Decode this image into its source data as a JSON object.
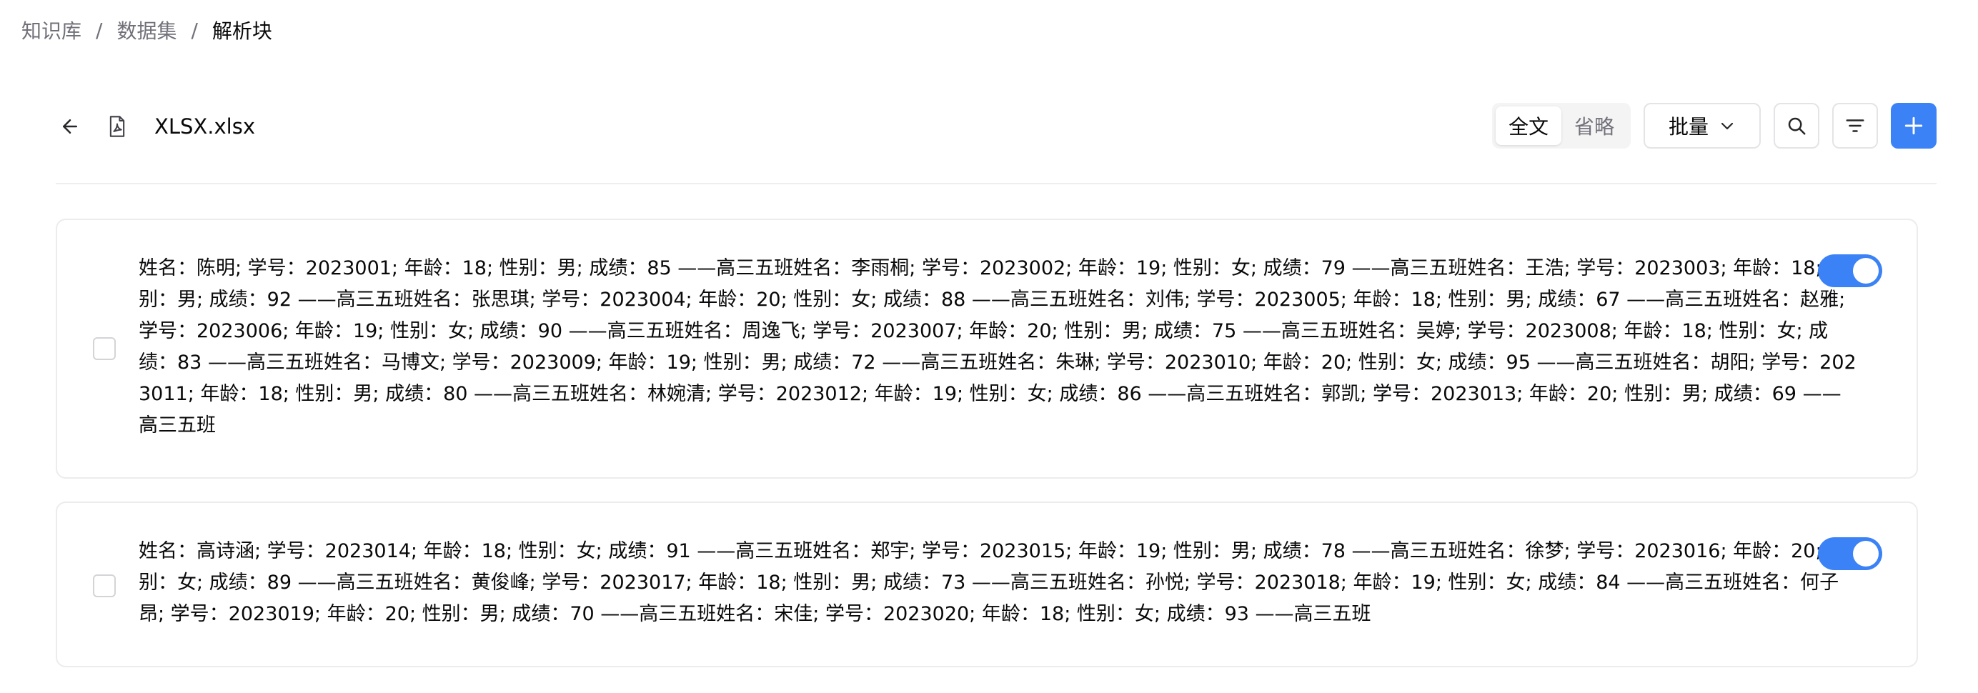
{
  "breadcrumb": {
    "items": [
      "知识库",
      "数据集",
      "解析块"
    ],
    "separator": "/"
  },
  "file": {
    "name": "XLSX.xlsx"
  },
  "toolbar": {
    "view_options": [
      "全文",
      "省略"
    ],
    "active_view": "全文",
    "batch_label": "批量"
  },
  "chunks": [
    {
      "text": "姓名：陈明; 学号：2023001; 年龄：18; 性别：男; 成绩：85 ——高三五班姓名：李雨桐; 学号：2023002; 年龄：19; 性别：女; 成绩：79 ——高三五班姓名：王浩; 学号：2023003; 年龄：18; 性别：男; 成绩：92 ——高三五班姓名：张思琪; 学号：2023004; 年龄：20; 性别：女; 成绩：88 ——高三五班姓名：刘伟; 学号：2023005; 年龄：18; 性别：男; 成绩：67 ——高三五班姓名：赵雅; 学号：2023006; 年龄：19; 性别：女; 成绩：90 ——高三五班姓名：周逸飞; 学号：2023007; 年龄：20; 性别：男; 成绩：75 ——高三五班姓名：吴婷; 学号：2023008; 年龄：18; 性别：女; 成绩：83 ——高三五班姓名：马博文; 学号：2023009; 年龄：19; 性别：男; 成绩：72 ——高三五班姓名：朱琳; 学号：2023010; 年龄：20; 性别：女; 成绩：95 ——高三五班姓名：胡阳; 学号：2023011; 年龄：18; 性别：男; 成绩：80 ——高三五班姓名：林婉清; 学号：2023012; 年龄：19; 性别：女; 成绩：86 ——高三五班姓名：郭凯; 学号：2023013; 年龄：20; 性别：男; 成绩：69 ——高三五班",
      "enabled": true
    },
    {
      "text": "姓名：高诗涵; 学号：2023014; 年龄：18; 性别：女; 成绩：91 ——高三五班姓名：郑宇; 学号：2023015; 年龄：19; 性别：男; 成绩：78 ——高三五班姓名：徐梦; 学号：2023016; 年龄：20; 性别：女; 成绩：89 ——高三五班姓名：黄俊峰; 学号：2023017; 年龄：18; 性别：男; 成绩：73 ——高三五班姓名：孙悦; 学号：2023018; 年龄：19; 性别：女; 成绩：84 ——高三五班姓名：何子昂; 学号：2023019; 年龄：20; 性别：男; 成绩：70 ——高三五班姓名：宋佳; 学号：2023020; 年龄：18; 性别：女; 成绩：93 ——高三五班",
      "enabled": true
    }
  ],
  "colors": {
    "accent": "#3b82f6",
    "muted_text": "#71717a",
    "border": "#e4e4e7"
  },
  "icons": [
    "arrow-left-icon",
    "file-icon",
    "chevron-down-icon",
    "search-icon",
    "filter-icon",
    "plus-icon"
  ]
}
